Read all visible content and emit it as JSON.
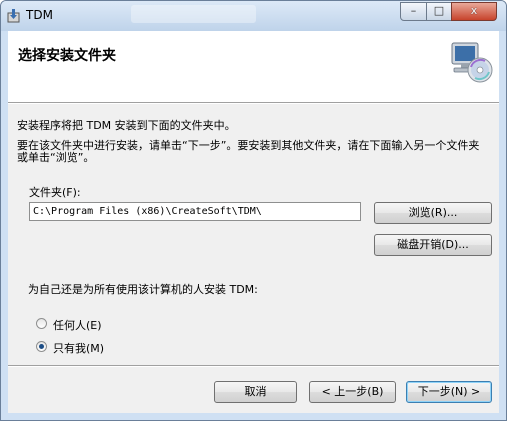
{
  "window": {
    "title": "TDM",
    "minimize_glyph": "–",
    "maximize_glyph": "□",
    "close_glyph": "x"
  },
  "header": {
    "title": "选择安装文件夹"
  },
  "body": {
    "intro": "安装程序将把 TDM 安装到下面的文件夹中。",
    "instructions": "要在该文件夹中进行安装，请单击“下一步”。要安装到其他文件夹，请在下面输入另一个文件夹或单击“浏览”。",
    "folder_label": "文件夹(F):",
    "folder_path": "C:\\Program Files (x86)\\CreateSoft\\TDM\\",
    "browse_label": "浏览(R)...",
    "disk_cost_label": "磁盘开销(D)...",
    "install_for_question": "为自己还是为所有使用该计算机的人安装 TDM:",
    "options": [
      {
        "label": "任何人(E)",
        "selected": false
      },
      {
        "label": "只有我(M)",
        "selected": true
      }
    ]
  },
  "footer": {
    "cancel_label": "取消",
    "back_label": "< 上一步(B)",
    "next_label": "下一步(N) >"
  }
}
